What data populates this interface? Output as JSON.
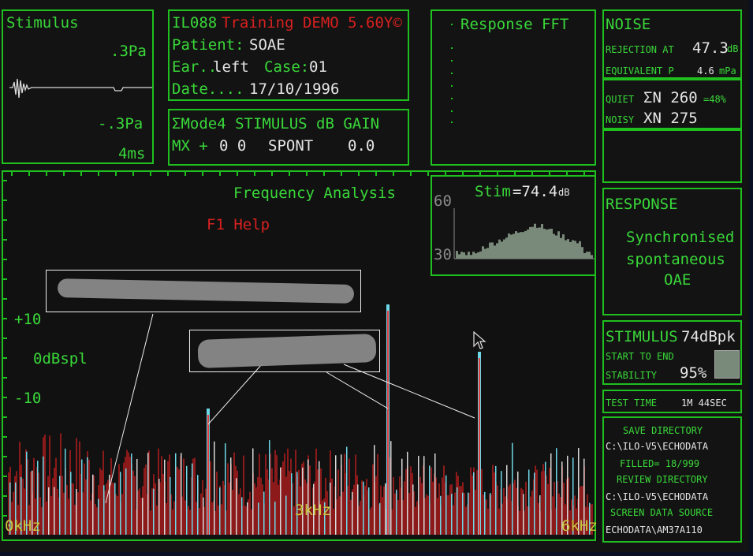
{
  "stimulus": {
    "title": "Stimulus",
    "top_label": ".3Pa",
    "bottom_label": "-.3Pa",
    "time_label": "4ms"
  },
  "header": {
    "code": "IL088",
    "title": "Training DEMO 5.60Y©",
    "patient_label": "Patient:",
    "patient": "SOAE",
    "ear_label": "Ear..",
    "ear": "left",
    "case_label": "Case:",
    "case": "01",
    "date_label": "Date....",
    "date": "17/10/1996"
  },
  "mode": {
    "line1": "ΣMode4 STIMULUS dB GAIN",
    "line2_prefix": "MX +",
    "line2_values": "0 0",
    "line2_stim": "SPONT",
    "line2_gain": "0.0"
  },
  "response_fft": {
    "title": "Response FFT"
  },
  "noise": {
    "title": "NOISE",
    "rejection_label": "REJECTION AT",
    "rejection_value": "47.3",
    "rejection_unit": "dB",
    "equiv_label": "EQUIVALENT P",
    "equiv_value": "4.6",
    "equiv_unit": "mPa",
    "quiet_label": "QUIET",
    "quiet_value": "ΣN 260",
    "quiet_pct": "=48%",
    "noisy_label": "NOISY",
    "noisy_value": "XN 275"
  },
  "response": {
    "title": "RESPONSE",
    "line1": "Synchronised",
    "line2": "spontaneous",
    "line3": "OAE"
  },
  "stimulus_box": {
    "title": "STIMULUS",
    "value": "74dBpk",
    "line2": "START TO END",
    "line3_label": "STABILITY",
    "line3_value": "95%"
  },
  "test_time": {
    "label": "TEST TIME",
    "value": "1M 44SEC"
  },
  "save": {
    "save_label": "SAVE DIRECTORY",
    "save_path": "C:\\ILO-V5\\ECHODATA",
    "filled": "FILLED= 18/999",
    "review_label": "REVIEW DIRECTORY",
    "review_path": "C:\\ILO-V5\\ECHODATA",
    "source_label": "SCREEN DATA SOURCE",
    "source_path": "ECHODATA\\AM37A110"
  },
  "analysis": {
    "title": "Frequency Analysis",
    "help": "F1 Help",
    "y_plus10": "+10",
    "y_zero": "0dBspl",
    "y_minus10": "-10",
    "x_0": "0kHz",
    "x_3": "3kHz",
    "x_6": "6kHz"
  },
  "stim_inset": {
    "label": "Stim",
    "value": "=74.4",
    "unit": "dB",
    "y_top": "60",
    "y_bottom": "30"
  },
  "colors": {
    "frame": "#1fbf1f",
    "text_green": "#39d839",
    "text_red": "#d82020",
    "noise_red": "#8c1a1a",
    "peak_cyan": "#6fd8e8"
  }
}
